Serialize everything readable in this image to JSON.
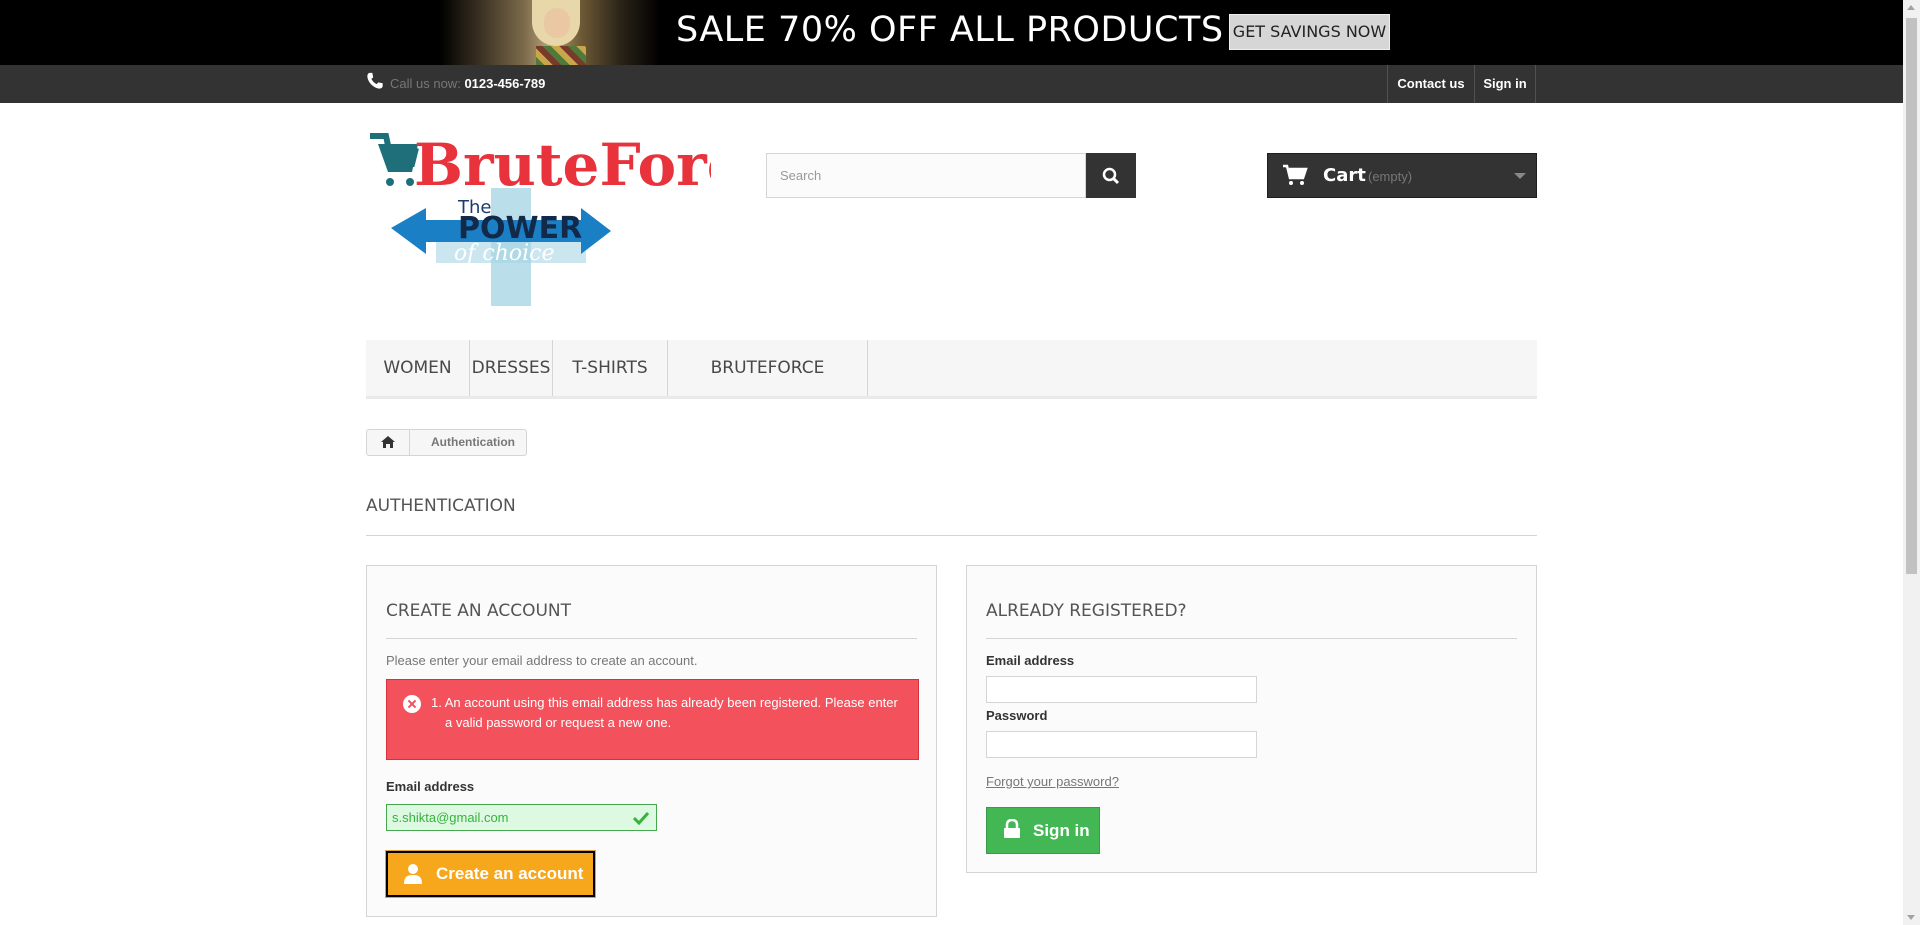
{
  "banner": {
    "headline": "SALE 70% OFF ALL PRODUCTS",
    "cta": "GET SAVINGS NOW"
  },
  "topbar": {
    "call_prefix": "Call us now:",
    "phone": "0123-456-789",
    "contact": "Contact us",
    "signin": "Sign in",
    "phone_icon": "phone-icon"
  },
  "logo": {
    "brand": "BruteForce",
    "tagline_the": "The",
    "tagline_power": "POWER",
    "tagline_choice": "of choice"
  },
  "search": {
    "placeholder": "Search"
  },
  "cart": {
    "label": "Cart",
    "status": "(empty)"
  },
  "menu": {
    "items": [
      "WOMEN",
      "DRESSES",
      "T-SHIRTS",
      "BRUTEFORCE"
    ]
  },
  "breadcrumb": {
    "current": "Authentication"
  },
  "page": {
    "title": "AUTHENTICATION"
  },
  "create_account": {
    "title": "CREATE AN ACCOUNT",
    "intro": "Please enter your email address to create an account.",
    "error_line1": "1. An account using this email address has already been registered. Please enter",
    "error_line2": "a valid password or request a new one.",
    "email_label": "Email address",
    "email_value": "s.shikta@gmail.com",
    "button": "Create an account"
  },
  "login": {
    "title": "ALREADY REGISTERED?",
    "email_label": "Email address",
    "password_label": "Password",
    "forgot": "Forgot your password?",
    "button": "Sign in"
  },
  "colors": {
    "alert": "#f3515c",
    "create_button": "#f7a71b",
    "signin_button": "#43b754",
    "brand_red": "#e8323c",
    "brand_blue": "#1a7fc4"
  }
}
